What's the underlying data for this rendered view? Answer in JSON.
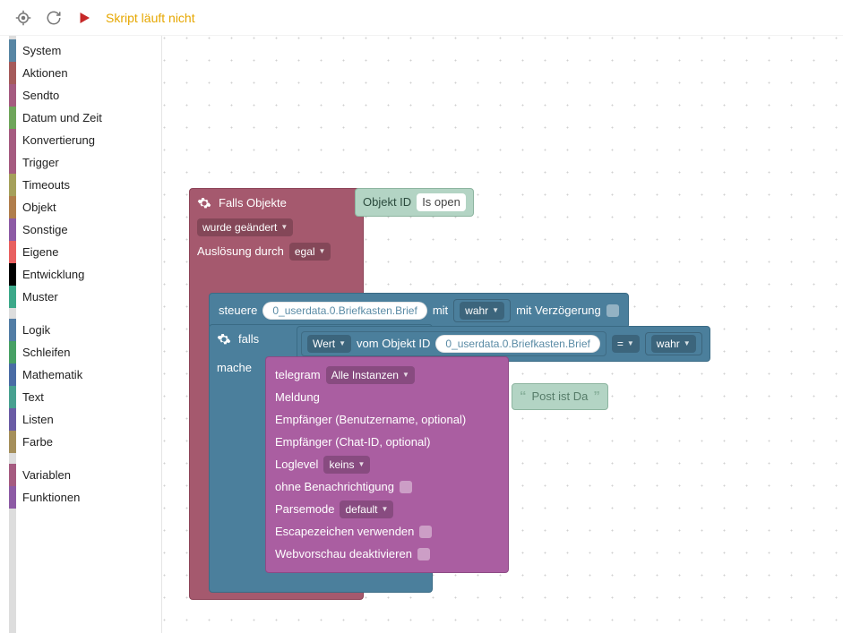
{
  "toolbar": {
    "status_text": "Skript läuft nicht"
  },
  "toolbox_categories": [
    {
      "label": "System",
      "color": "#5886A4"
    },
    {
      "label": "Aktionen",
      "color": "#A55B5B"
    },
    {
      "label": "Sendto",
      "color": "#A55B80"
    },
    {
      "label": "Datum und Zeit",
      "color": "#6FA55B"
    },
    {
      "label": "Konvertierung",
      "color": "#A55B80"
    },
    {
      "label": "Trigger",
      "color": "#A55B80"
    },
    {
      "label": "Timeouts",
      "color": "#A5A05B"
    },
    {
      "label": "Objekt",
      "color": "#B07E4C"
    },
    {
      "label": "Sonstige",
      "color": "#8D5BA5"
    },
    {
      "label": "Eigene",
      "color": "#E86060"
    },
    {
      "label": "Entwicklung",
      "color": "#000000"
    },
    {
      "label": "Muster",
      "color": "#3CA889"
    }
  ],
  "toolbox_categories2": [
    {
      "label": "Logik",
      "color": "#527DA5"
    },
    {
      "label": "Schleifen",
      "color": "#48A065"
    },
    {
      "label": "Mathematik",
      "color": "#4A6CA5"
    },
    {
      "label": "Text",
      "color": "#48A090"
    },
    {
      "label": "Listen",
      "color": "#6A5CA5"
    },
    {
      "label": "Farbe",
      "color": "#A58F5B"
    }
  ],
  "toolbox_categories3": [
    {
      "label": "Variablen",
      "color": "#A55B80"
    },
    {
      "label": "Funktionen",
      "color": "#8D5BA5"
    }
  ],
  "blocks": {
    "trigger": {
      "title": "Falls Objekte",
      "changed": "wurde geändert",
      "cause_lbl": "Auslösung durch",
      "cause_val": "egal"
    },
    "objid_chip": {
      "prefix": "Objekt ID",
      "value": "Is open"
    },
    "steuere": {
      "verb": "steuere",
      "object": "0_userdata.0.Briefkasten.Brief",
      "mit": "mit",
      "wahr": "wahr",
      "delay_lbl": "mit Verzögerung"
    },
    "falls": {
      "if_lbl": "falls",
      "do_lbl": "mache"
    },
    "compare": {
      "wert": "Wert",
      "vom": "vom Objekt ID",
      "obj": "0_userdata.0.Briefkasten.Brief",
      "op": "=",
      "rhs": "wahr"
    },
    "telegram": {
      "name": "telegram",
      "instance": "Alle Instanzen",
      "msg_lbl": "Meldung",
      "recipient_user": "Empfänger (Benutzername, optional)",
      "recipient_chat": "Empfänger (Chat-ID, optional)",
      "loglevel_lbl": "Loglevel",
      "loglevel_val": "keins",
      "no_notify": "ohne Benachrichtigung",
      "parsemode_lbl": "Parsemode",
      "parsemode_val": "default",
      "escape": "Escapezeichen verwenden",
      "no_preview": "Webvorschau deaktivieren"
    },
    "message": "Post ist Da"
  }
}
